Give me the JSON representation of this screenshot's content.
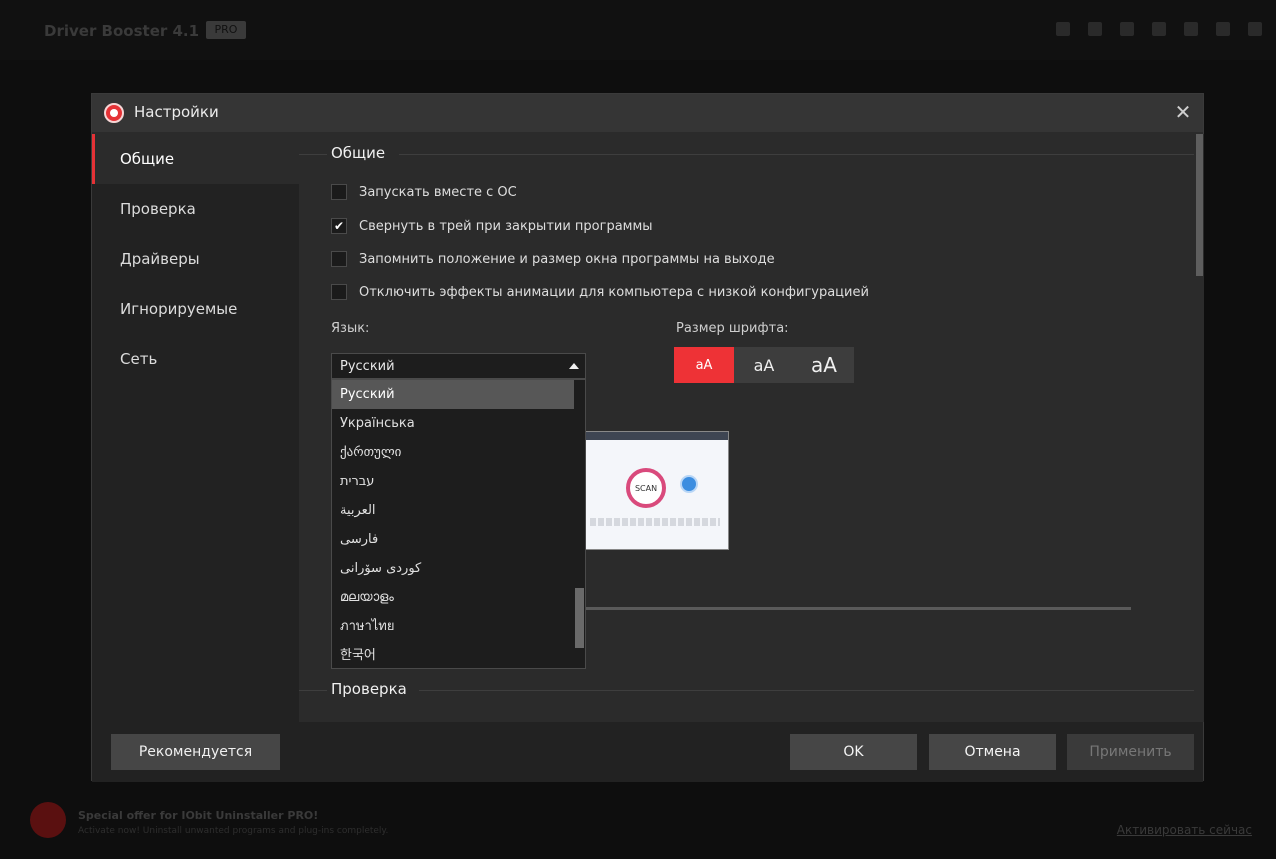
{
  "background_app": {
    "title": "Driver Booster 4.1",
    "badge": "PRO",
    "offer_title": "Special offer for IObit Uninstaller PRO!",
    "offer_subtitle": "Activate now! Uninstall unwanted programs and plug-ins completely.",
    "offer_link": "Активировать сейчас"
  },
  "dialog": {
    "title": "Настройки",
    "close_glyph": "✕"
  },
  "sidebar": {
    "items": [
      {
        "label": "Общие",
        "active": true
      },
      {
        "label": "Проверка",
        "active": false
      },
      {
        "label": "Драйверы",
        "active": false
      },
      {
        "label": "Игнорируемые",
        "active": false
      },
      {
        "label": "Сеть",
        "active": false
      }
    ]
  },
  "general": {
    "section_title": "Общие",
    "checkboxes": [
      {
        "label": "Запускать вместе с ОС",
        "checked": false
      },
      {
        "label": "Свернуть в трей при закрытии программы",
        "checked": true
      },
      {
        "label": "Запомнить положение и размер окна программы на выходе",
        "checked": false
      },
      {
        "label": "Отключить эффекты анимации для компьютера с низкой конфигурацией",
        "checked": false
      }
    ],
    "language_label": "Язык:",
    "language_selected": "Русский",
    "language_options": [
      "Русский",
      "Українська",
      "ქართული",
      "עברית",
      "العربية",
      "فارسی",
      "کوردی سۆرانی",
      "മലയാളം",
      "ภาษาไทย",
      "한국어"
    ],
    "font_size_label": "Размер шрифта:",
    "font_sizes": [
      "aA",
      "aA",
      "aA"
    ],
    "font_size_selected_index": 0,
    "preview_scan_label": "SCAN"
  },
  "check_section": {
    "section_title": "Проверка"
  },
  "footer": {
    "recommended": "Рекомендуется",
    "ok": "OK",
    "cancel": "Отмена",
    "apply": "Применить"
  },
  "colors": {
    "accent": "#ee3236",
    "dialog_bg": "#2b2b2b",
    "sidebar_bg": "#222222"
  }
}
